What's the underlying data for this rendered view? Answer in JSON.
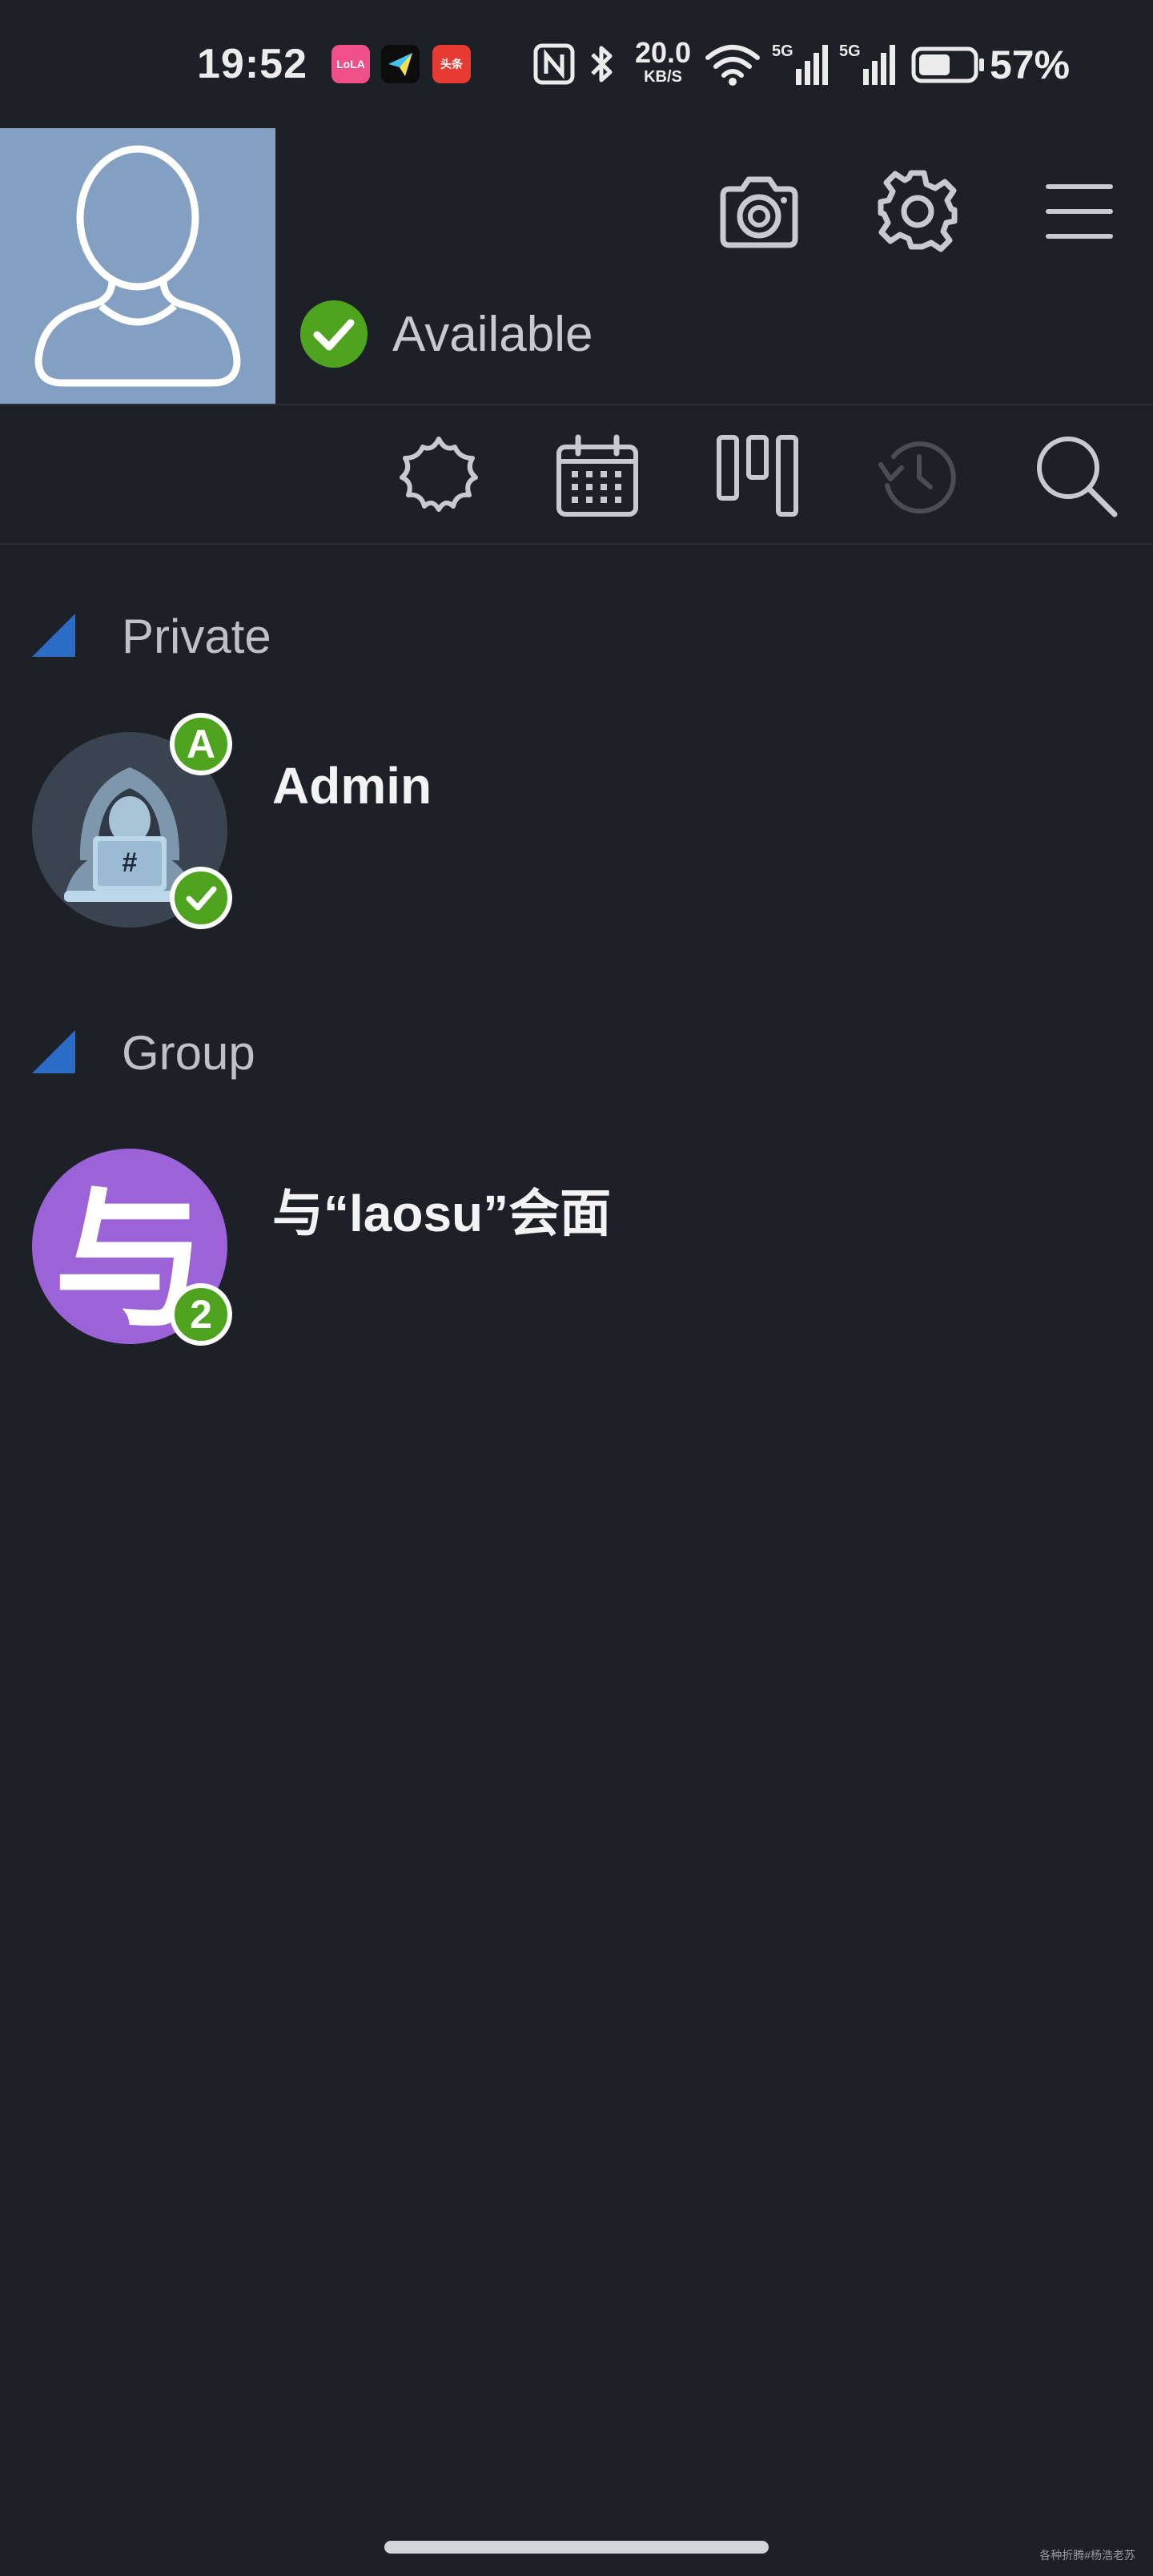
{
  "status_bar": {
    "time": "19:52",
    "apps": [
      "LoLA",
      "今日头条"
    ],
    "app_labels": {
      "lola": "LoLA",
      "toutiao": "头条"
    },
    "net_speed_value": "20.0",
    "net_speed_unit": "KB/S",
    "signal1_label": "5G",
    "signal2_label": "5G",
    "battery_percent": "57%",
    "icons": [
      "nfc-icon",
      "bluetooth-icon",
      "wifi-icon",
      "signal-icon",
      "signal-icon",
      "battery-icon"
    ]
  },
  "header": {
    "presence_label": "Available",
    "actions": [
      "camera-icon",
      "settings-icon",
      "menu-icon"
    ]
  },
  "toolbar": {
    "items": [
      "starburst-icon",
      "calendar-icon",
      "board-icon",
      "history-icon",
      "search-icon"
    ]
  },
  "sections": [
    {
      "title": "Private",
      "contacts": [
        {
          "name": "Admin",
          "badge": "A",
          "status": "online"
        }
      ]
    },
    {
      "title": "Group",
      "contacts": [
        {
          "name": "与“laosu”会面",
          "avatar_char": "与",
          "badge": "2"
        }
      ]
    }
  ],
  "watermark": "各种折腾#杨浩老苏",
  "colors": {
    "background": "#1e2028",
    "accent_blue": "#2a6cc6",
    "status_green": "#4ea41f",
    "group_purple": "#9c63d8",
    "avatar_box": "#839fc2"
  }
}
